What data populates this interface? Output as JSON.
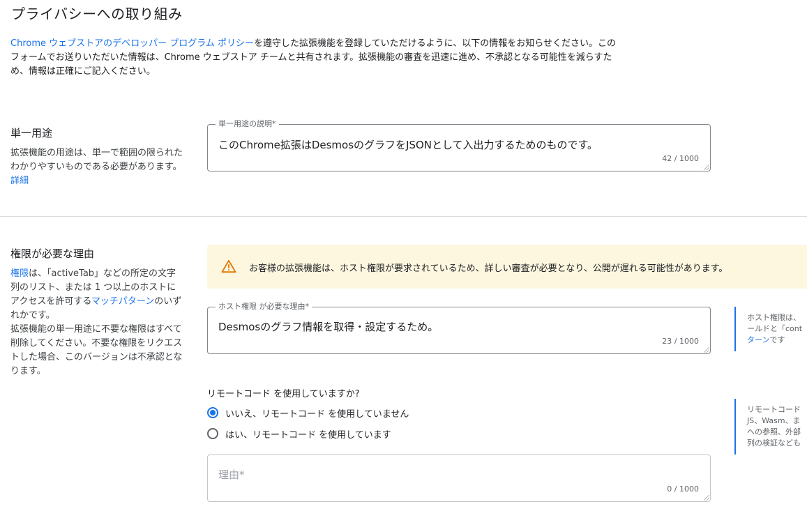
{
  "page": {
    "title": "プライバシーへの取り組み"
  },
  "intro": {
    "link_text": "Chrome ウェブストアのデベロッパー プログラム ポリシー",
    "text": "を遵守した拡張機能を登録していただけるように、以下の情報をお知らせください。このフォームでお送りいただいた情報は、Chrome ウェブストア チームと共有されます。拡張機能の審査を迅速に進め、不承認となる可能性を減らすため、情報は正確にご記入ください。"
  },
  "single_purpose": {
    "title": "単一用途",
    "description": "拡張機能の用途は、単一で範囲の限られたわかりやすいものである必要があります。",
    "link": "詳細",
    "field": {
      "label": "単一用途の説明*",
      "value": "このChrome拡張はDesmosのグラフをJSONとして入出力するためのものです。",
      "counter": "42 / 1000"
    }
  },
  "permissions": {
    "title": "権限が必要な理由",
    "desc_link1": "権限",
    "desc_part1": "は、「activeTab」などの所定の文字列のリスト、または 1 つ以上のホストにアクセスを許可する",
    "desc_link2": "マッチパターン",
    "desc_part2": "のいずれかです。",
    "desc_part3": "拡張機能の単一用途に不要な権限はすべて削除してください。不要な権限をリクエストした場合、このバージョンは不承認となります。",
    "warning": "お客様の拡張機能は、ホスト権限が要求されているため、詳しい審査が必要となり、公開が遅れる可能性があります。",
    "host_field": {
      "label": "ホスト権限 が必要な理由*",
      "value": "Desmosのグラフ情報を取得・設定するため。",
      "counter": "23 / 1000"
    },
    "host_note": {
      "line1": "ホスト権限は、",
      "line2": "ールドと「cont",
      "line3_link": "ターン",
      "line3_text": "です"
    }
  },
  "remote_code": {
    "question": "リモートコード を使用していますか?",
    "options": [
      {
        "label": "いいえ、リモートコード を使用していません",
        "checked": true
      },
      {
        "label": "はい、リモートコード を使用しています",
        "checked": false
      }
    ],
    "note": {
      "line1": "リモートコード",
      "line2": "JS、Wasm、ま",
      "line3": "への参照、外部",
      "line4": "列の検証なども"
    },
    "reason_field": {
      "placeholder": "理由*",
      "counter": "0 / 1000"
    }
  }
}
